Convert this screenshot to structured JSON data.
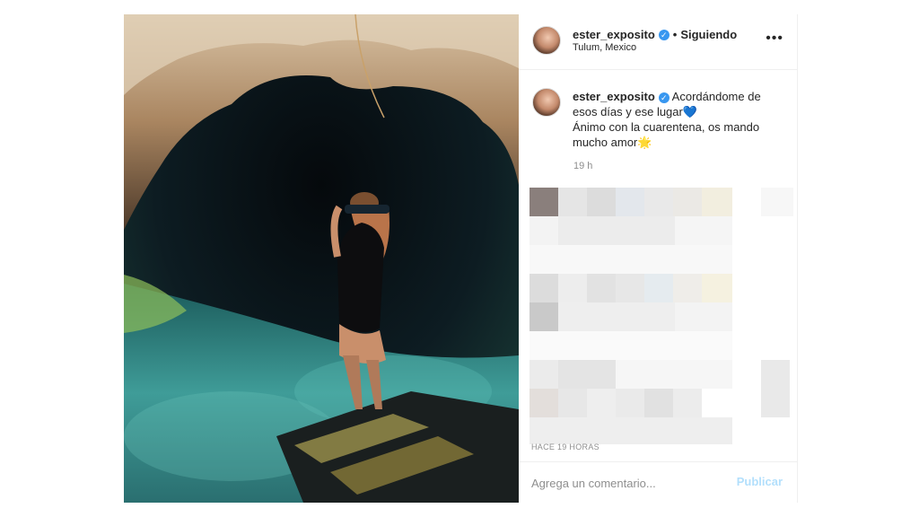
{
  "post": {
    "author": {
      "username": "ester_exposito",
      "verified_icon": "verified-badge-icon",
      "follow_status": "Siguiendo",
      "location": "Tulum, Mexico"
    },
    "options_icon": "more-options-icon",
    "caption": {
      "username": "ester_exposito",
      "line1": "Acordándome de esos días y ese lugar",
      "heart": "💙",
      "line2": "Ánimo con la cuarentena, os mando mucho amor",
      "star": "🌟",
      "age": "19 h"
    },
    "timestamp": "HACE 19 HORAS",
    "comment": {
      "placeholder": "Agrega un comentario...",
      "value": "",
      "publish_label": "Publicar"
    },
    "colors": {
      "verified": "#3897f0",
      "publish_disabled": "#b2dffc",
      "muted_text": "#8e8e8e"
    }
  }
}
